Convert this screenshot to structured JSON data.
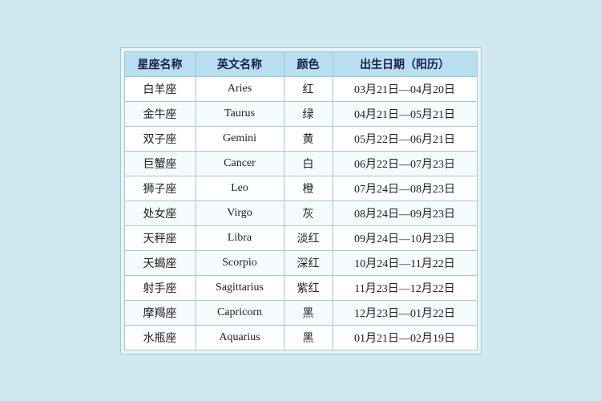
{
  "table": {
    "headers": {
      "col1": "星座名称",
      "col2": "英文名称",
      "col3": "颜色",
      "col4": "出生日期（阳历）"
    },
    "rows": [
      {
        "name": "白羊座",
        "en": "Aries",
        "color": "红",
        "date": "03月21日—04月20日"
      },
      {
        "name": "金牛座",
        "en": "Taurus",
        "color": "绿",
        "date": "04月21日—05月21日"
      },
      {
        "name": "双子座",
        "en": "Gemini",
        "color": "黄",
        "date": "05月22日—06月21日"
      },
      {
        "name": "巨蟹座",
        "en": "Cancer",
        "color": "白",
        "date": "06月22日—07月23日"
      },
      {
        "name": "狮子座",
        "en": "Leo",
        "color": "橙",
        "date": "07月24日—08月23日"
      },
      {
        "name": "处女座",
        "en": "Virgo",
        "color": "灰",
        "date": "08月24日—09月23日"
      },
      {
        "name": "天秤座",
        "en": "Libra",
        "color": "淡红",
        "date": "09月24日—10月23日"
      },
      {
        "name": "天蝎座",
        "en": "Scorpio",
        "color": "深红",
        "date": "10月24日—11月22日"
      },
      {
        "name": "射手座",
        "en": "Sagittarius",
        "color": "紫红",
        "date": "11月23日—12月22日"
      },
      {
        "name": "摩羯座",
        "en": "Capricorn",
        "color": "黑",
        "date": "12月23日—01月22日"
      },
      {
        "name": "水瓶座",
        "en": "Aquarius",
        "color": "黑",
        "date": "01月21日—02月19日"
      }
    ]
  }
}
